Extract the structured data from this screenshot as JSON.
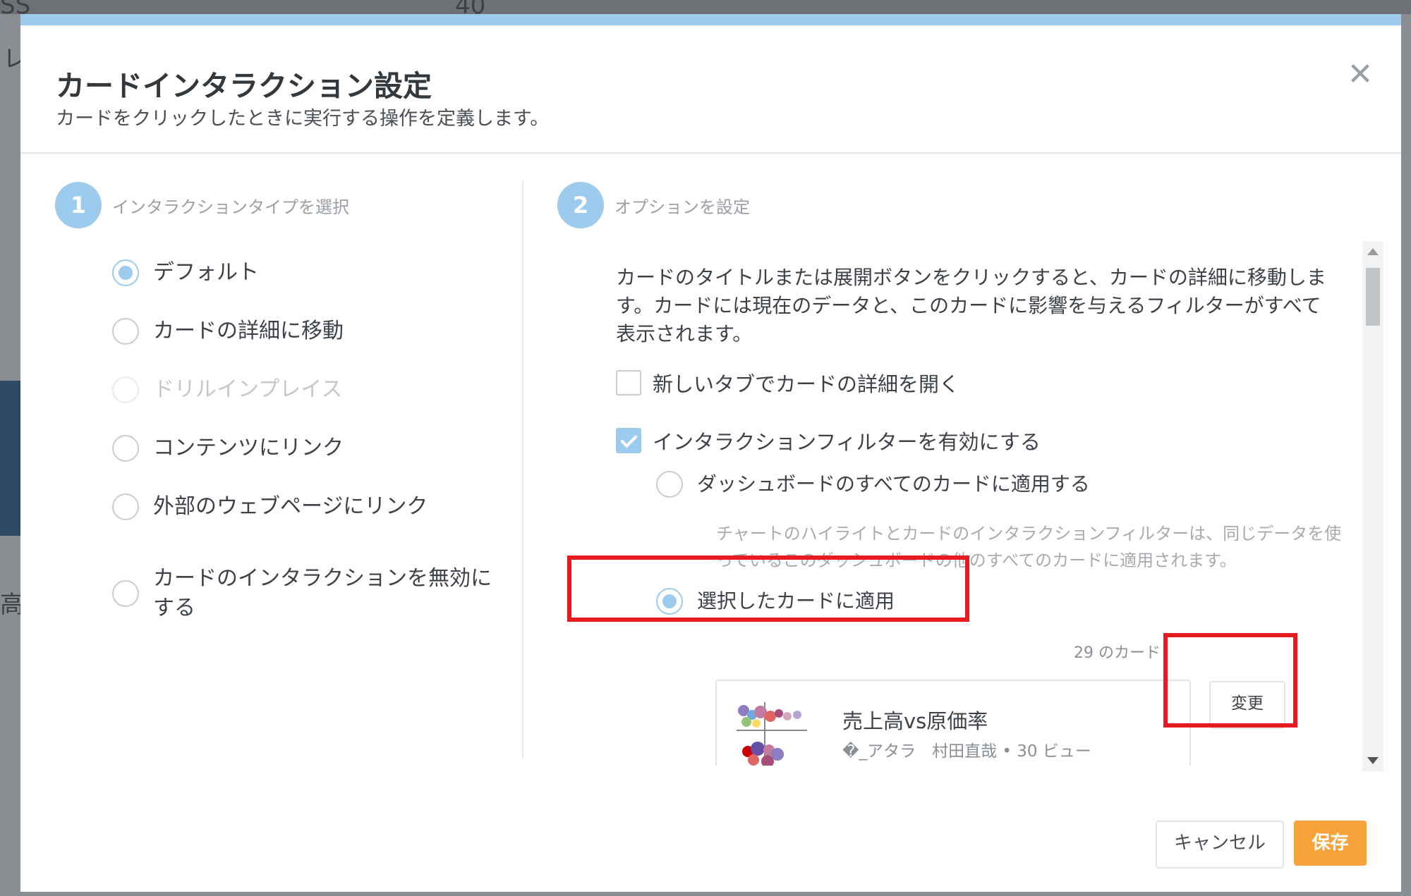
{
  "background": {
    "texts": [
      "SS",
      "40",
      "レ",
      "高"
    ]
  },
  "dialog": {
    "title": "カードインタラクション設定",
    "subtitle": "カードをクリックしたときに実行する操作を定義します。",
    "close_icon": "close-icon"
  },
  "step1": {
    "number": "1",
    "label": "インタラクションタイプを選択",
    "options": [
      {
        "label": "デフォルト",
        "checked": true,
        "disabled": false
      },
      {
        "label": "カードの詳細に移動",
        "checked": false,
        "disabled": false
      },
      {
        "label": "ドリルインプレイス",
        "checked": false,
        "disabled": true
      },
      {
        "label": "コンテンツにリンク",
        "checked": false,
        "disabled": false
      },
      {
        "label": "外部のウェブページにリンク",
        "checked": false,
        "disabled": false
      },
      {
        "label": "カードのインタラクションを無効に",
        "label_line2": "する",
        "checked": false,
        "disabled": false
      }
    ]
  },
  "step2": {
    "number": "2",
    "label": "オプションを設定",
    "description": "カードのタイトルまたは展開ボタンをクリックすると、カードの詳細に移動します。カードには現在のデータと、このカードに影響を与えるフィルターがすべて表示されます。",
    "open_new_tab": {
      "label": "新しいタブでカードの詳細を開く",
      "checked": false
    },
    "enable_filter": {
      "label": "インタラクションフィルターを有効にする",
      "checked": true
    },
    "apply_all": {
      "label": "ダッシュボードのすべてのカードに適用する",
      "checked": false,
      "hint": "チャートのハイライトとカードのインタラクションフィルターは、同じデータを使っているこのダッシュボードの他のすべてのカードに適用されます。"
    },
    "apply_selected": {
      "label": "選択したカードに適用",
      "checked": true
    },
    "card_count": "29 のカード",
    "card": {
      "title": "売上高vs原価率",
      "meta": "�_アタラ　村田直哉 • 30 ビュー"
    },
    "change_label": "変更"
  },
  "footer": {
    "cancel_label": "キャンセル",
    "save_label": "保存"
  },
  "colors": {
    "accent": "#9dcbee",
    "save": "#f7a23b",
    "highlight": "#e8191f"
  }
}
